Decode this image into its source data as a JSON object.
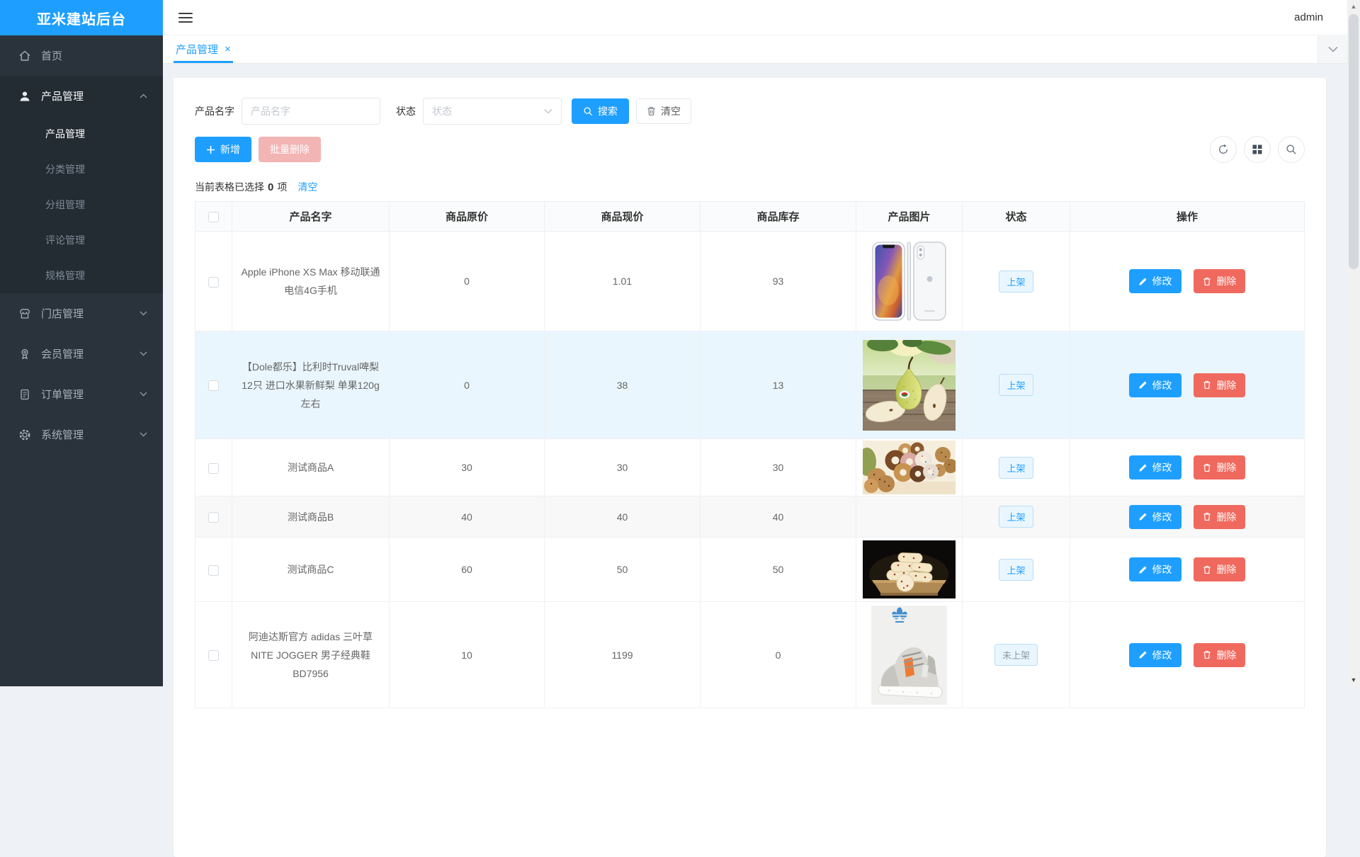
{
  "app": {
    "title": "亚米建站后台"
  },
  "header": {
    "user": "admin"
  },
  "sidebar": {
    "home": "首页",
    "product": "产品管理",
    "product_children": [
      "产品管理",
      "分类管理",
      "分组管理",
      "评论管理",
      "规格管理"
    ],
    "active_child": "产品管理",
    "store": "门店管理",
    "member": "会员管理",
    "order": "订单管理",
    "system": "系统管理"
  },
  "tabs": {
    "active_label": "产品管理",
    "close_glyph": "×"
  },
  "filters": {
    "name_label": "产品名字",
    "name_placeholder": "产品名字",
    "status_label": "状态",
    "status_placeholder": "状态",
    "search_label": "搜索",
    "clear_label": "清空"
  },
  "toolbar": {
    "add_label": "新增",
    "batch_delete_label": "批量删除"
  },
  "selection": {
    "prefix": "当前表格已选择",
    "count": "0",
    "suffix": "项",
    "clear_label": "清空"
  },
  "table": {
    "columns": [
      "产品名字",
      "商品原价",
      "商品现价",
      "商品库存",
      "产品图片",
      "状态",
      "操作"
    ],
    "edit_label": "修改",
    "delete_label": "删除",
    "rows": [
      {
        "name": "Apple iPhone XS Max 移动联通电信4G手机",
        "original_price": "0",
        "current_price": "1.01",
        "stock": "93",
        "image": "iphone-xs-max-photo",
        "status": "上架"
      },
      {
        "name": "【Dole都乐】比利时Truval啤梨12只 进口水果新鲜梨 单果120g左右",
        "original_price": "0",
        "current_price": "38",
        "stock": "13",
        "image": "pear-photo",
        "status": "上架"
      },
      {
        "name": "测试商品A",
        "original_price": "30",
        "current_price": "30",
        "stock": "30",
        "image": "donuts-photo",
        "status": "上架"
      },
      {
        "name": "测试商品B",
        "original_price": "40",
        "current_price": "40",
        "stock": "40",
        "image": "",
        "status": "上架"
      },
      {
        "name": "测试商品C",
        "original_price": "60",
        "current_price": "50",
        "stock": "50",
        "image": "cookies-photo",
        "status": "上架"
      },
      {
        "name": "阿迪达斯官方 adidas 三叶草 NITE JOGGER 男子经典鞋BD7956",
        "original_price": "10",
        "current_price": "1199",
        "stock": "0",
        "image": "adidas-sneaker-photo",
        "status": "未上架"
      }
    ]
  },
  "colors": {
    "primary": "#1E9FFF",
    "delete_button": "#F0695E",
    "batch_delete_disabled": "#F3B4B4",
    "badge_bg": "#EAF6FF",
    "badge_border": "#B9DEF5",
    "sidebar_bg": "#2A333C",
    "sidebar_group_bg": "#232B33",
    "row_hover_bg": "#EAF6FE"
  },
  "icons": {
    "menu_toggle": "hamburger-icon",
    "home": "home-icon",
    "product": "user-icon",
    "store": "store-icon",
    "member": "member-badge-icon",
    "order": "order-doc-icon",
    "system": "gear-icon",
    "expanded": "chevron-up-icon",
    "collapsed": "chevron-down-icon",
    "search": "search-icon",
    "clear": "trash-icon",
    "add": "plus-icon",
    "refresh": "refresh-icon",
    "columns": "grid-icon",
    "edit": "pencil-icon",
    "delete": "trash-icon",
    "tab_close": "close-icon"
  }
}
